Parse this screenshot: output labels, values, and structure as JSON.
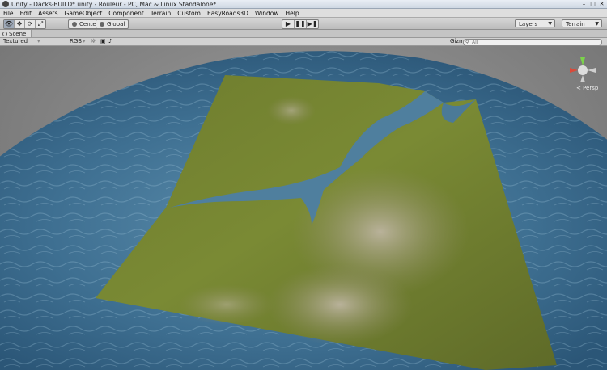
{
  "window": {
    "title": "Unity - Dacks-BUILD*.unity - Rouleur - PC, Mac & Linux Standalone*",
    "controls": [
      "–",
      "□",
      "✕"
    ]
  },
  "menu": [
    "File",
    "Edit",
    "Assets",
    "GameObject",
    "Component",
    "Terrain",
    "Custom",
    "EasyRoads3D",
    "Window",
    "Help"
  ],
  "toolbar": {
    "tools": [
      "hand-icon",
      "move-icon",
      "rotate-icon",
      "scale-icon"
    ],
    "pivot_label": "Center",
    "space_label": "Global",
    "play_buttons": [
      "▶",
      "❚❚",
      "▶❚"
    ],
    "layers_label": "Layers",
    "layout_label": "Terrain"
  },
  "tab": {
    "label": "Scene"
  },
  "scene_options": {
    "render_mode": "Textured",
    "color_mode": "RGB",
    "gizmos_label": "Gizmos",
    "search_placeholder": "All"
  },
  "gizmo": {
    "projection_label": "< Persp"
  }
}
